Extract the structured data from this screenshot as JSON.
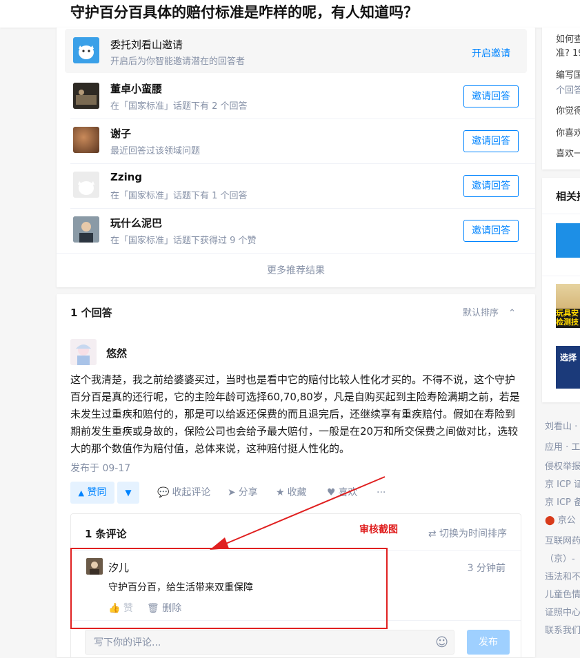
{
  "question": {
    "title": "守护百分百具体的赔付标准是咋样的呢，有人知道吗？"
  },
  "invite": {
    "delegate": {
      "name": "委托刘看山邀请",
      "desc": "开启后为你智能邀请潜在的回答者",
      "action": "开启邀请"
    },
    "users": [
      {
        "name": "董卓小蛮腰",
        "desc": "在「国家标准」话题下有 2 个回答",
        "button": "邀请回答"
      },
      {
        "name": "谢子",
        "desc": "最近回答过该领域问题",
        "button": "邀请回答"
      },
      {
        "name": "Zzing",
        "desc": "在「国家标准」话题下有 1 个回答",
        "button": "邀请回答"
      },
      {
        "name": "玩什么泥巴",
        "desc": "在「国家标准」话题下获得过 9 个赞",
        "button": "邀请回答"
      }
    ],
    "more": "更多推荐结果"
  },
  "answers": {
    "count_label": "1 个回答",
    "sort_label": "默认排序",
    "author": "悠然",
    "content": "这个我清楚，我之前给婆婆买过，当时也是看中它的赔付比较人性化才买的。不得不说，这个守护百分百是真的还行呢，它的主险年龄可选择60,70,80岁，凡是自购买起到主险寿险满期之前，若是未发生过重疾和赔付的，那是可以给返还保费的而且退完后，还继续享有重疾赔付。假如在寿险到期前发生重疾或身故的，保险公司也会给予最大赔付，一般是在20万和所交保费之间做对比，选较大的那个数值作为赔付值，总体来说，这种赔付挺人性化的。",
    "published": "发布于 09-17",
    "actions": {
      "upvote": "赞同",
      "collapse_comments": "收起评论",
      "share": "分享",
      "favorite": "收藏",
      "like": "喜欢",
      "more": "···"
    }
  },
  "comments": {
    "count_label": "1 条评论",
    "audit_label": "审核截图",
    "switch_sort": "切换为时间排序",
    "items": [
      {
        "author": "汐儿",
        "time": "3 分钟前",
        "text": "守护百分百，给生活带来双重保障",
        "like": "赞",
        "delete": "删除"
      }
    ],
    "input_placeholder": "写下你的评论...",
    "publish": "发布"
  },
  "sidebar": {
    "links": [
      "如何查",
      "准? 19",
      "编写国",
      "个回答",
      "你觉得",
      "你喜欢",
      "喜欢一"
    ],
    "related_title": "相关推",
    "thumb_labels": [
      "玩具安",
      "检测技",
      "选择"
    ],
    "footer": [
      "刘看山 ·",
      "应用 · 工",
      "侵权举报",
      "京 ICP 证",
      "京 ICP 备",
      "京公",
      "互联网药",
      "（京）-",
      "违法和不",
      "儿童色情",
      "证照中心",
      "联系我们"
    ]
  },
  "colors": {
    "accent": "#0084ff",
    "audit_red": "#e02020"
  }
}
